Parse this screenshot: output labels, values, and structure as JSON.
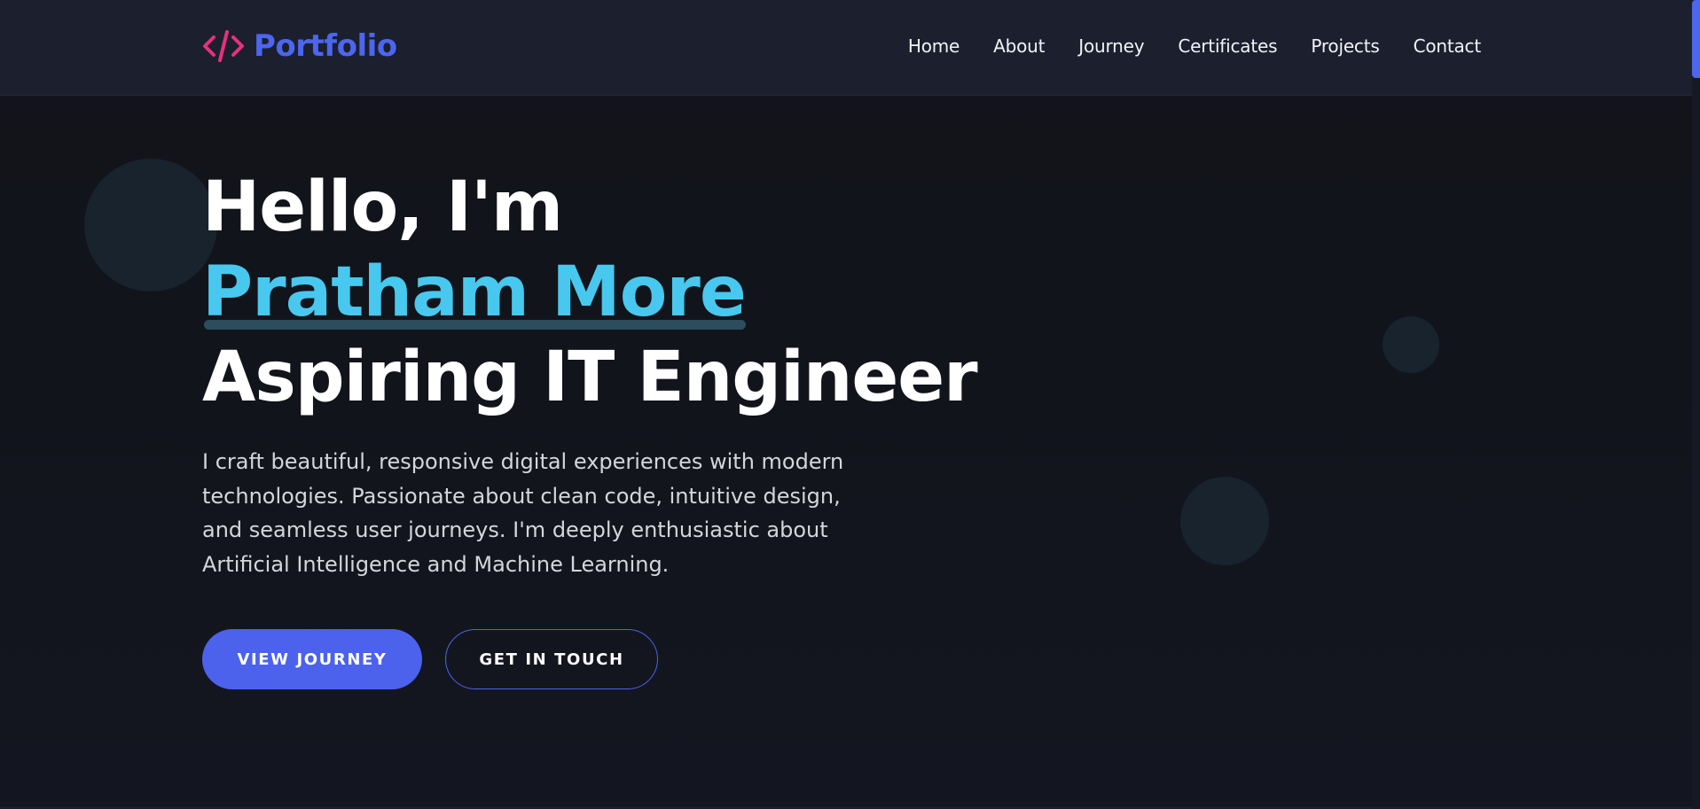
{
  "header": {
    "brand_icon": "code-brackets-icon",
    "brand_text": "Portfolio",
    "nav": [
      {
        "label": "Home"
      },
      {
        "label": "About"
      },
      {
        "label": "Journey"
      },
      {
        "label": "Certificates"
      },
      {
        "label": "Projects"
      },
      {
        "label": "Contact"
      }
    ]
  },
  "hero": {
    "greeting": "Hello, I'm",
    "name": "Pratham More",
    "role": "Aspiring IT Engineer",
    "description": "I craft beautiful, responsive digital experiences with modern technologies. Passionate about clean code, intuitive design, and seamless user journeys. I'm deeply enthusiastic about Artificial Intelligence and Machine Learning.",
    "primary_button": "VIEW JOURNEY",
    "secondary_button": "GET IN TOUCH"
  },
  "colors": {
    "background": "#12141c",
    "navbar": "#1c1f2e",
    "accent": "#4c62ec",
    "brand_pink": "#e6317d",
    "name_cyan": "#48c8ee"
  }
}
